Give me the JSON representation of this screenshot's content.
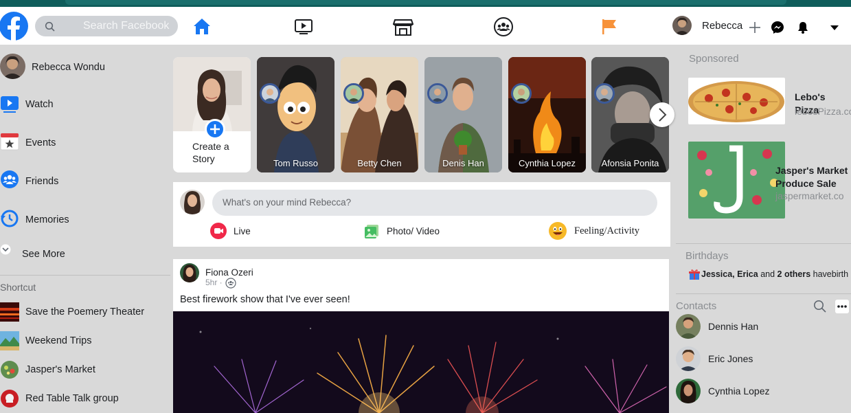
{
  "header": {
    "search_placeholder": "Search Facebook",
    "user_name": "Rebecca",
    "nav_icons": [
      "home-icon",
      "watch-icon",
      "marketplace-icon",
      "groups-icon",
      "pages-flag-icon"
    ],
    "accent": "#1877f2"
  },
  "left_sidebar": {
    "profile_name": "Rebecca Wondu",
    "items": [
      {
        "label": "Watch",
        "icon": "watch-icon"
      },
      {
        "label": "Events",
        "icon": "events-icon"
      },
      {
        "label": "Friends",
        "icon": "friends-icon"
      },
      {
        "label": "Memories",
        "icon": "memories-icon"
      },
      {
        "label": "See More",
        "icon": "chevron-down-icon"
      }
    ],
    "shortcut_title": "Shortcut",
    "shortcuts": [
      {
        "label": "Save the Poemery Theater"
      },
      {
        "label": "Weekend Trips"
      },
      {
        "label": "Jasper's Market"
      },
      {
        "label": "Red Table Talk group"
      }
    ]
  },
  "stories": {
    "create_label_1": "Create a",
    "create_label_2": "Story",
    "items": [
      {
        "name": "Tom Russo"
      },
      {
        "name": "Betty Chen"
      },
      {
        "name": "Denis Han"
      },
      {
        "name": "Cynthia Lopez"
      },
      {
        "name": "Afonsia Ponita"
      }
    ]
  },
  "composer": {
    "placeholder": "What's on your mind Rebecca?",
    "actions": [
      {
        "label": "Live",
        "icon": "live-video-icon"
      },
      {
        "label": "Photo/ Video",
        "icon": "photo-icon"
      },
      {
        "label": "Feeling/Activity",
        "icon": "feeling-emoji-icon"
      }
    ]
  },
  "post": {
    "author": "Fiona Ozeri",
    "time": "5hr ·",
    "text": "Best firework show that I've ever seen!"
  },
  "right_sidebar": {
    "sponsored_title": "Sponsored",
    "ads": [
      {
        "name": "Lebo's Pizza",
        "url": "lebosPizza.co"
      },
      {
        "name": "Jasper's Market Produce Sale",
        "url": "jaspermarket.co"
      }
    ],
    "ad2_name_1": "Jasper's Market",
    "ad2_name_2": "Produce Sale",
    "birthdays_title": "Birthdays",
    "birthday_names": "Jessica, Erica",
    "birthday_and": " and ",
    "birthday_others": "2 others",
    "birthday_tail": " havebirth",
    "contacts_title": "Contacts",
    "contacts": [
      {
        "name": "Dennis Han"
      },
      {
        "name": "Eric Jones"
      },
      {
        "name": "Cynthia Lopez"
      }
    ]
  }
}
